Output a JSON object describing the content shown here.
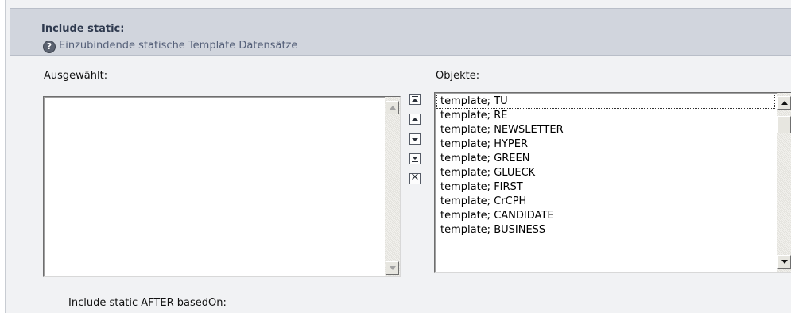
{
  "header": {
    "title": "Include static:",
    "help_glyph": "?",
    "description": "Einzubindende statische Template Datensätze"
  },
  "selected_list": {
    "label": "Ausgewählt:",
    "items": []
  },
  "objects_list": {
    "label": "Objekte:",
    "items": [
      "template; TU",
      "template; RE",
      "template; NEWSLETTER",
      "template; HYPER",
      "template; GREEN",
      "template; GLUECK",
      "template; FIRST",
      "template; CrCPH",
      "template; CANDIDATE",
      "template; BUSINESS"
    ],
    "focused_index": 0
  },
  "move_controls": {
    "icons": [
      "move-to-top-icon",
      "move-up-icon",
      "move-down-icon",
      "move-to-bottom-icon",
      "remove-icon"
    ],
    "remove_glyph": "✕"
  },
  "footer": {
    "after_label": "Include static AFTER basedOn:"
  },
  "colors": {
    "header_bg": "#d1d5dd",
    "panel_bg": "#f1f2f4",
    "title_color": "#2f3a4f"
  }
}
